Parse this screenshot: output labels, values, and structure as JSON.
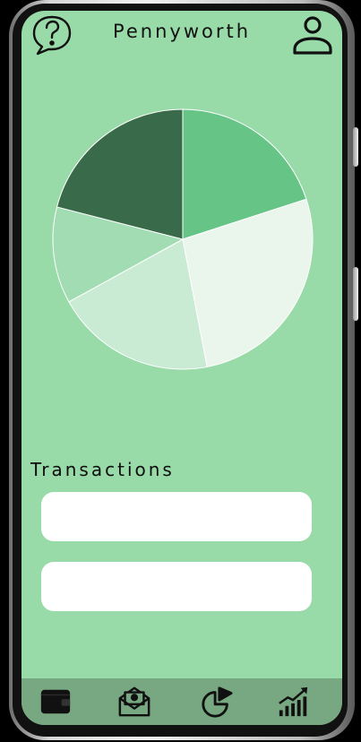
{
  "app": {
    "title": "Pennyworth"
  },
  "icons": {
    "help": "help-chat-icon",
    "profile": "user-profile-icon",
    "nav": [
      "wallet-icon",
      "mail-icon",
      "pie-chart-icon",
      "growth-chart-icon"
    ]
  },
  "chart_data": {
    "type": "pie",
    "values": [
      20,
      27,
      20,
      12,
      21
    ],
    "colors": [
      "#65c486",
      "#eaf5ec",
      "#c9ead3",
      "#a2dcb2",
      "#396b4b"
    ],
    "title": ""
  },
  "transactions": {
    "title": "Transactions",
    "items": [
      "",
      ""
    ]
  },
  "colors": {
    "screen_bg": "#98dba8",
    "nav_bg": "#78a882",
    "card_bg": "#ffffff"
  }
}
